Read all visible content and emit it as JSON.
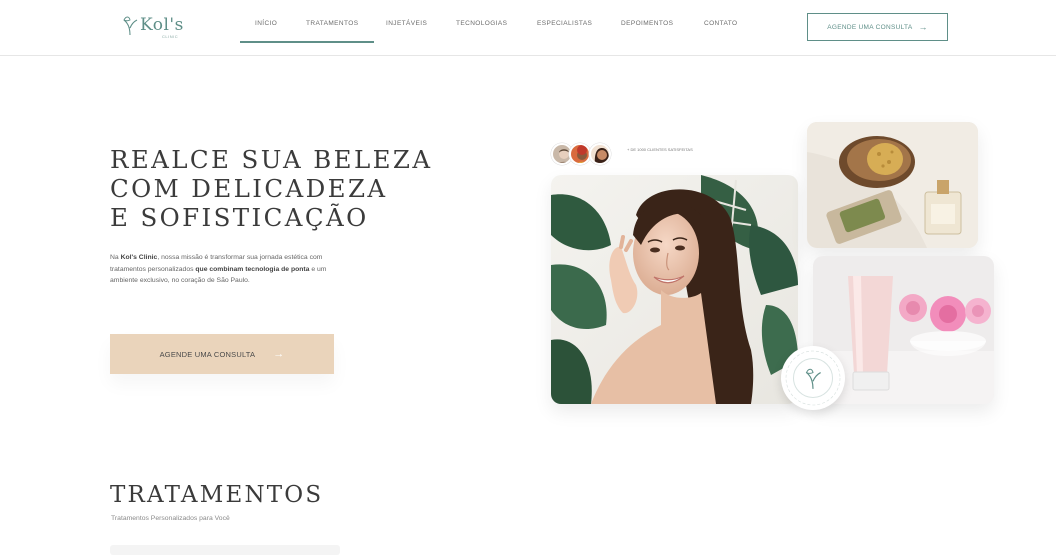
{
  "nav": {
    "logo_text": "Kol's",
    "logo_sub": "CLINIC",
    "items": [
      {
        "label": "INÍCIO"
      },
      {
        "label": "TRATAMENTOS"
      },
      {
        "label": "INJETÁVEIS"
      },
      {
        "label": "TECNOLOGIAS"
      },
      {
        "label": "ESPECIALISTAS"
      },
      {
        "label": "DEPOIMENTOS"
      },
      {
        "label": "CONTATO"
      }
    ],
    "cta_label": "AGENDE UMA CONSULTA",
    "cta_arrow": "→"
  },
  "hero": {
    "title_lines": [
      "REALCE SUA BELEZA",
      "COM DELICADEZA",
      "E SOFISTICAÇÃO"
    ],
    "text_pre": "Na ",
    "text_brand": "Kol's Clinic",
    "text_mid": ", nossa missão é transformar sua jornada estética com tratamentos personalizados ",
    "text_bold": "que combinam tecnologia de ponta",
    "text_post": " e um ambiente exclusivo, no coração de São Paulo.",
    "cta_label": "AGENDE UMA CONSULTA",
    "cta_arrow": "→"
  },
  "collage": {
    "testimonial_text": "+ DE 1000 CLIENTES SATISFEITAS"
  },
  "section": {
    "title": "TRATAMENTOS",
    "subtitle": "Tratamentos Personalizados para Você"
  },
  "colors": {
    "accent": "#5f8f88",
    "cta_bg": "#ead4bb"
  }
}
